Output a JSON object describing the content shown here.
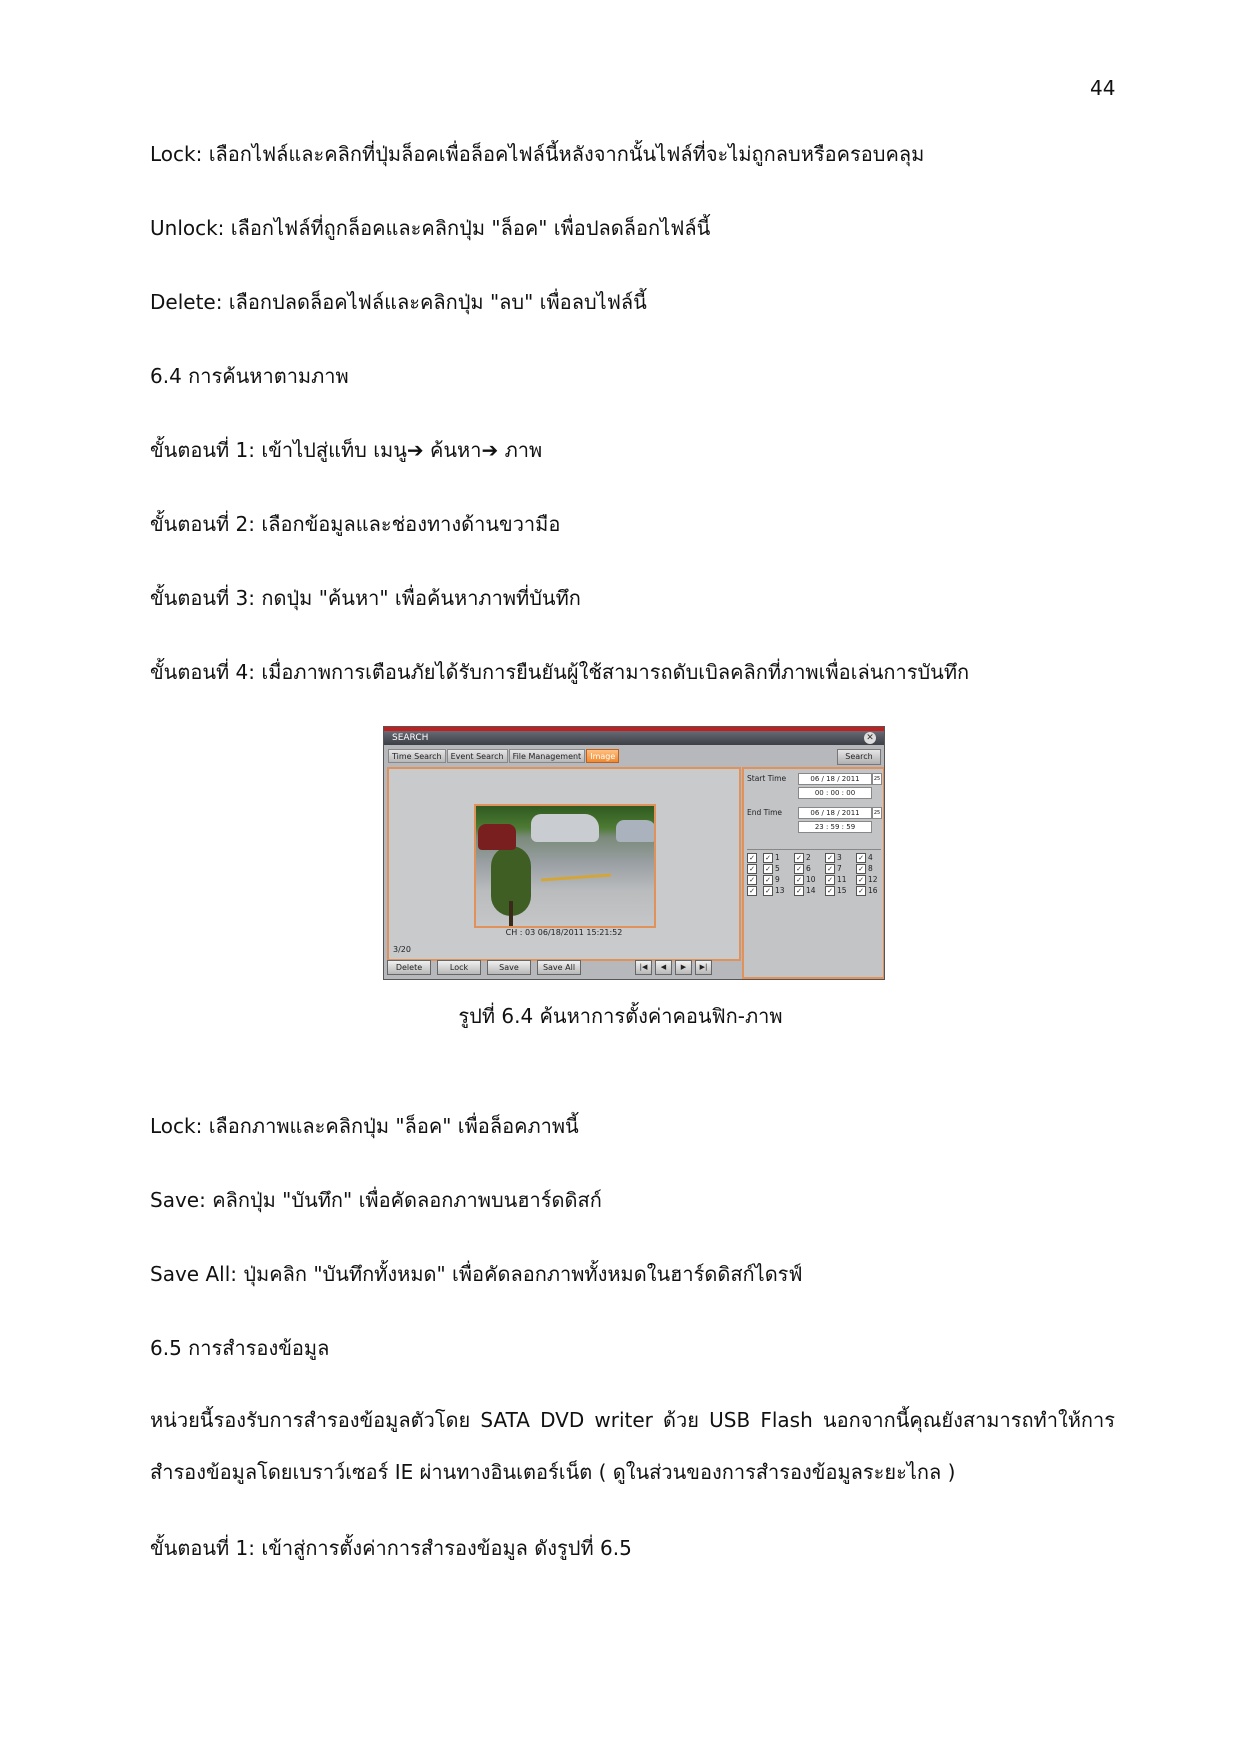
{
  "page_number": "44",
  "paragraphs_top": [
    "Lock: เลือกไฟล์และคลิกที่ปุ่มล็อคเพื่อล็อคไฟล์นี้หลังจากนั้นไฟล์ที่จะไม่ถูกลบหรือครอบคลุม",
    "Unlock: เลือกไฟล์ที่ถูกล็อคและคลิกปุ่ม \"ล็อค\" เพื่อปลดล็อกไฟล์นี้",
    "Delete: เลือกปลดล็อคไฟล์และคลิกปุ่ม \"ลบ\" เพื่อลบไฟล์นี้",
    "6.4 การค้นหาตามภาพ",
    "ขั้นตอนที่ 1: เข้าไปสู่แท็บ เมนู➔ ค้นหา➔ ภาพ",
    "ขั้นตอนที่ 2: เลือกข้อมูลและช่องทางด้านขวามือ",
    "ขั้นตอนที่ 3: กดปุ่ม \"ค้นหา\" เพื่อค้นหาภาพที่บันทึก",
    "ขั้นตอนที่ 4: เมื่อภาพการเตือนภัยได้รับการยืนยันผู้ใช้สามารถดับเบิลคลิกที่ภาพเพื่อเล่นการบันทึก"
  ],
  "screenshot": {
    "title": "SEARCH",
    "close": "✕",
    "tabs": [
      "Time Search",
      "Event Search",
      "File Management",
      "Image"
    ],
    "search_button": "Search",
    "ch_label": "CH : 03  06/18/2011 15:21:52",
    "count": "3/20",
    "buttons": [
      "Delete",
      "Lock",
      "Save",
      "Save All"
    ],
    "nav": [
      "|◀",
      "◀",
      "▶",
      "▶|"
    ],
    "start_time_label": "Start Time",
    "start_date": "06 / 18 / 2011",
    "start_time": "00  :  00  :  00",
    "end_time_label": "End Time",
    "end_date": "06 / 18 / 2011",
    "end_time": "23  :  59  :  59",
    "calendar_icon": "25",
    "check": "✓",
    "channels": [
      "1",
      "2",
      "3",
      "4",
      "5",
      "6",
      "7",
      "8",
      "9",
      "10",
      "11",
      "12",
      "13",
      "14",
      "15",
      "16"
    ]
  },
  "caption": "รูปที่ 6.4 ค้นหาการตั้งค่าคอนฟิก-ภาพ",
  "paragraphs_bottom": [
    "Lock: เลือกภาพและคลิกปุ่ม \"ล็อค\" เพื่อล็อคภาพนี้",
    "Save: คลิกปุ่ม \"บันทึก\" เพื่อคัดลอกภาพบนฮาร์ดดิสก์",
    "Save All: ปุ่มคลิก \"บันทึกทั้งหมด\" เพื่อคัดลอกภาพทั้งหมดในฮาร์ดดิสก์ไดรฟ์",
    "6.5 การสำรองข้อมูล"
  ],
  "backup_paragraph": "หน่วยนี้รองรับการสำรองข้อมูลตัวโดย SATA DVD writer ด้วย USB Flash นอกจากนี้คุณยังสามารถทำให้การสำรองข้อมูลโดยเบราว์เซอร์ IE ผ่านทางอินเตอร์เน็ต ( ดูในส่วนของการสำรองข้อมูลระยะไกล )",
  "last_step": "ขั้นตอนที่ 1: เข้าสู่การตั้งค่าการสำรองข้อมูล ดังรูปที่  6.5"
}
